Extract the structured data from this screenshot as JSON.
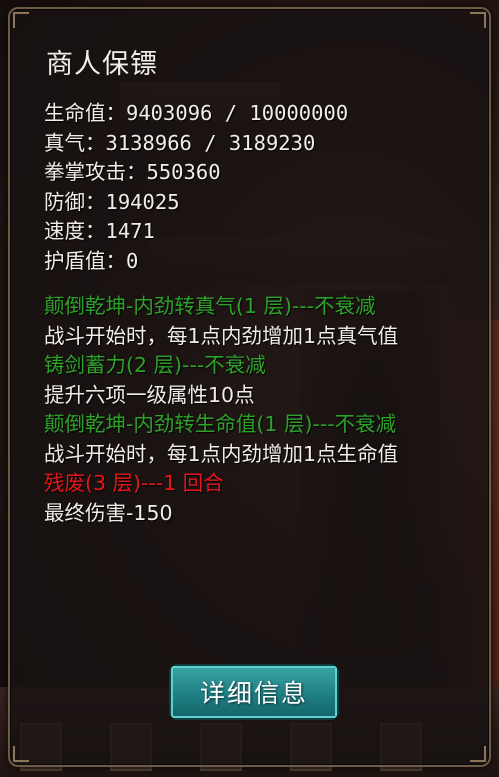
{
  "panel": {
    "title": "商人保镖",
    "stats": [
      {
        "label": "生命值：",
        "value": "9403096 / 10000000"
      },
      {
        "label": "真气：",
        "value": "3138966 / 3189230"
      },
      {
        "label": "拳掌攻击：",
        "value": "550360"
      },
      {
        "label": "防御：",
        "value": "194025"
      },
      {
        "label": "速度：",
        "value": "1471"
      },
      {
        "label": "护盾值：",
        "value": "0"
      }
    ],
    "effects": [
      {
        "name": "颠倒乾坤-内劲转真气(1 层)---不衰减",
        "desc": "战斗开始时，每1点内劲增加1点真气值",
        "type": "buff"
      },
      {
        "name": "铸剑蓄力(2 层)---不衰减",
        "desc": "提升六项一级属性10点",
        "type": "buff"
      },
      {
        "name": "颠倒乾坤-内劲转生命值(1 层)---不衰减",
        "desc": "战斗开始时，每1点内劲增加1点生命值",
        "type": "buff"
      },
      {
        "name": "残废(3 层)---1 回合",
        "desc": "最终伤害-150",
        "type": "debuff"
      }
    ],
    "detail_button": "详细信息"
  },
  "colors": {
    "buff_text": "#2ea12a",
    "debuff_text": "#e5161b",
    "button_bg": "#1f7f83"
  }
}
